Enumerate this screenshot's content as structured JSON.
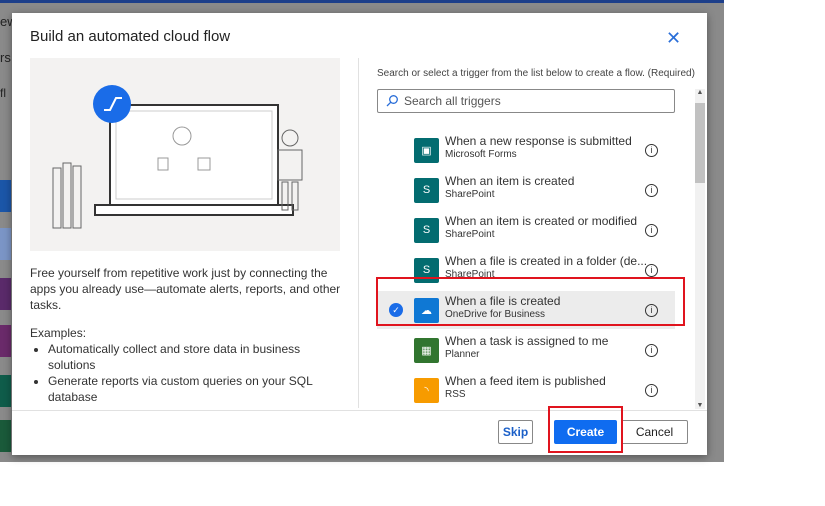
{
  "background": {
    "text1": "ew",
    "text2": "rs",
    "text3": "fl"
  },
  "dialog": {
    "title": "Build an automated cloud flow",
    "close_icon": "close-icon",
    "description": "Free yourself from repetitive work just by connecting the apps you already use—automate alerts, reports, and other tasks.",
    "examples_label": "Examples:",
    "examples": [
      "Automatically collect and store data in business solutions",
      "Generate reports via custom queries on your SQL database"
    ],
    "trigger_hint": "Search or select a trigger from the list below to create a flow. (Required)",
    "search_placeholder": "Search all triggers",
    "triggers": [
      {
        "title": "When a new response is submitted",
        "connector": "Microsoft Forms",
        "color": "#036c70",
        "selected": false
      },
      {
        "title": "When an item is created",
        "connector": "SharePoint",
        "color": "#036c70",
        "selected": false
      },
      {
        "title": "When an item is created or modified",
        "connector": "SharePoint",
        "color": "#036c70",
        "selected": false
      },
      {
        "title": "When a file is created in a folder (de...",
        "connector": "SharePoint",
        "color": "#036c70",
        "selected": false
      },
      {
        "title": "When a file is created",
        "connector": "OneDrive for Business",
        "color": "#0f78d4",
        "selected": true
      },
      {
        "title": "When a task is assigned to me",
        "connector": "Planner",
        "color": "#31752f",
        "selected": false
      },
      {
        "title": "When a feed item is published",
        "connector": "RSS",
        "color": "#f79b00",
        "selected": false
      }
    ],
    "buttons": {
      "skip": "Skip",
      "create": "Create",
      "cancel": "Cancel"
    }
  }
}
